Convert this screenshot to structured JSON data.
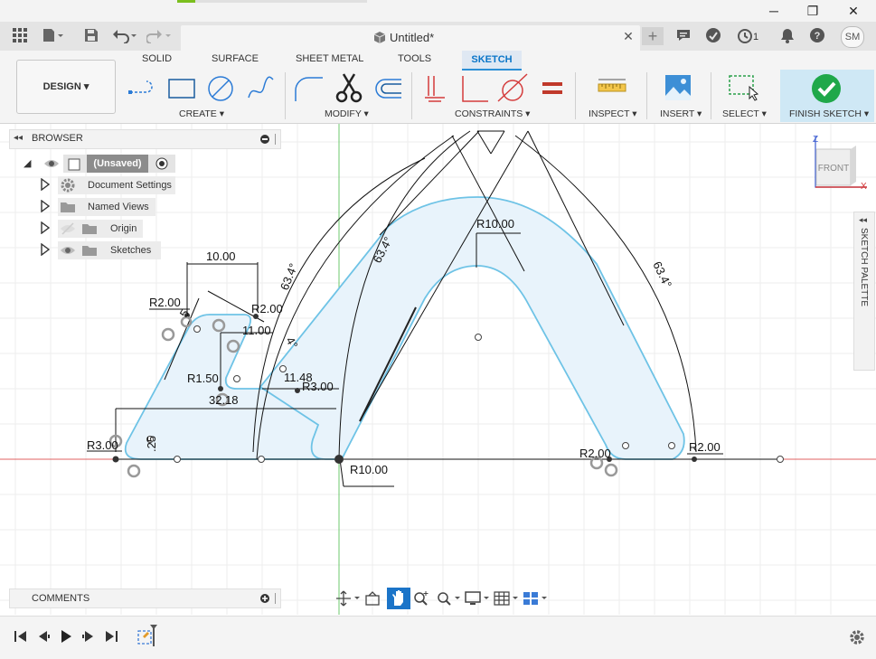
{
  "window": {
    "title": "Untitled*",
    "minimize_glyph": "─",
    "restore_glyph": "❐",
    "close_glyph": "✕"
  },
  "qat": {
    "job_count": "1",
    "user_initials": "SM",
    "tab_close_glyph": "✕",
    "add_tab_glyph": "+"
  },
  "ribbon": {
    "tabs": [
      "SOLID",
      "SURFACE",
      "SHEET METAL",
      "TOOLS",
      "SKETCH"
    ],
    "active_tab": "SKETCH",
    "workspace": "DESIGN ▾",
    "groups": {
      "create": "CREATE ▾",
      "modify": "MODIFY ▾",
      "constraints": "CONSTRAINTS ▾",
      "inspect": "INSPECT ▾",
      "insert": "INSERT ▾",
      "select": "SELECT ▾",
      "finish": "FINISH SKETCH ▾"
    }
  },
  "browser": {
    "title": "BROWSER",
    "root": "(Unsaved)",
    "items": [
      "Document Settings",
      "Named Views",
      "Origin",
      "Sketches"
    ]
  },
  "comments": {
    "title": "COMMENTS"
  },
  "palette": {
    "title": "SKETCH PALETTE"
  },
  "viewcube": {
    "face": "FRONT",
    "axis_z": "Z",
    "axis_x": "X"
  },
  "dimensions": {
    "d1": "10.00",
    "d2": "R2.00",
    "d3": "R2.00",
    "d4": "11.00",
    "d5": "R1.50",
    "d6": "32.18",
    "d7": "11.48",
    "d8": "R3.00",
    "d9": "R3.00",
    "d10": "R10.00",
    "d11": "R10.00",
    "d12": "R2.00",
    "d13": "R2.00",
    "d14": "63.4°",
    "d15": "63.4°",
    "d16": "63.4°",
    "d17": "4°",
    "d18": ".25",
    "d19": "5"
  },
  "colors": {
    "accent": "#0a75c8",
    "sketch_line": "#6ec3e6",
    "profile_fill": "#e8f3fb",
    "finish_check": "#1fa84a",
    "x_axis": "#e06060",
    "y_axis": "#6cc86c"
  }
}
